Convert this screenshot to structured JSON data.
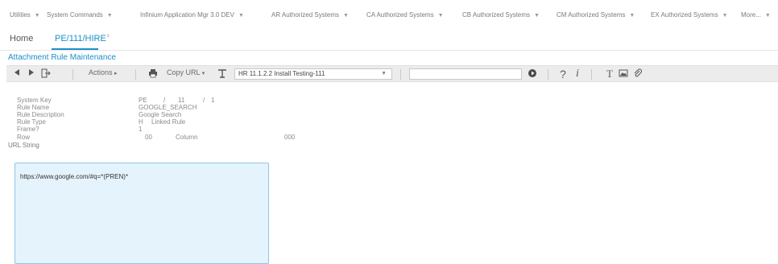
{
  "top_menu": [
    {
      "label": "Utilities"
    },
    {
      "label": "System Commands"
    },
    {
      "label": "Infinium Application Mgr 3.0 DEV"
    },
    {
      "label": "AR Authorized Systems"
    },
    {
      "label": "CA Authorized Systems"
    },
    {
      "label": "CB Authorized Systems"
    },
    {
      "label": "CM Authorized Systems"
    },
    {
      "label": "EX Authorized Systems"
    },
    {
      "label": "More..."
    }
  ],
  "tabs": {
    "home": "Home",
    "active": "PE/111/HIRE",
    "active_badge": "x"
  },
  "page_title": "Attachment Rule Maintenance",
  "toolbar": {
    "actions_label": "Actions",
    "actions_caret": "▸",
    "copy_url_label": "Copy URL",
    "copy_url_caret": "▾",
    "rule_select_value": "HR 11.1.2.2 Install Testing-111",
    "search_value": ""
  },
  "form": {
    "system_key": {
      "label": "System Key",
      "v1": "PE",
      "sep1": "/",
      "v2": "11",
      "sep2": "/",
      "v3": "1"
    },
    "rule_name": {
      "label": "Rule Name",
      "value": "GOOGLE_SEARCH"
    },
    "rule_description": {
      "label": "Rule Description",
      "value": "Google Search"
    },
    "rule_type": {
      "label": "Rule Type",
      "value": "H",
      "value_desc": "Linked Rule"
    },
    "frame": {
      "label": "Frame?",
      "value": "1"
    },
    "row": {
      "label": "Row",
      "value": "00",
      "column_label": "Column",
      "column_value": "000"
    },
    "url_string": {
      "label": "URL String",
      "value": "https://www.google.com/#q=*(PREN)*"
    }
  }
}
